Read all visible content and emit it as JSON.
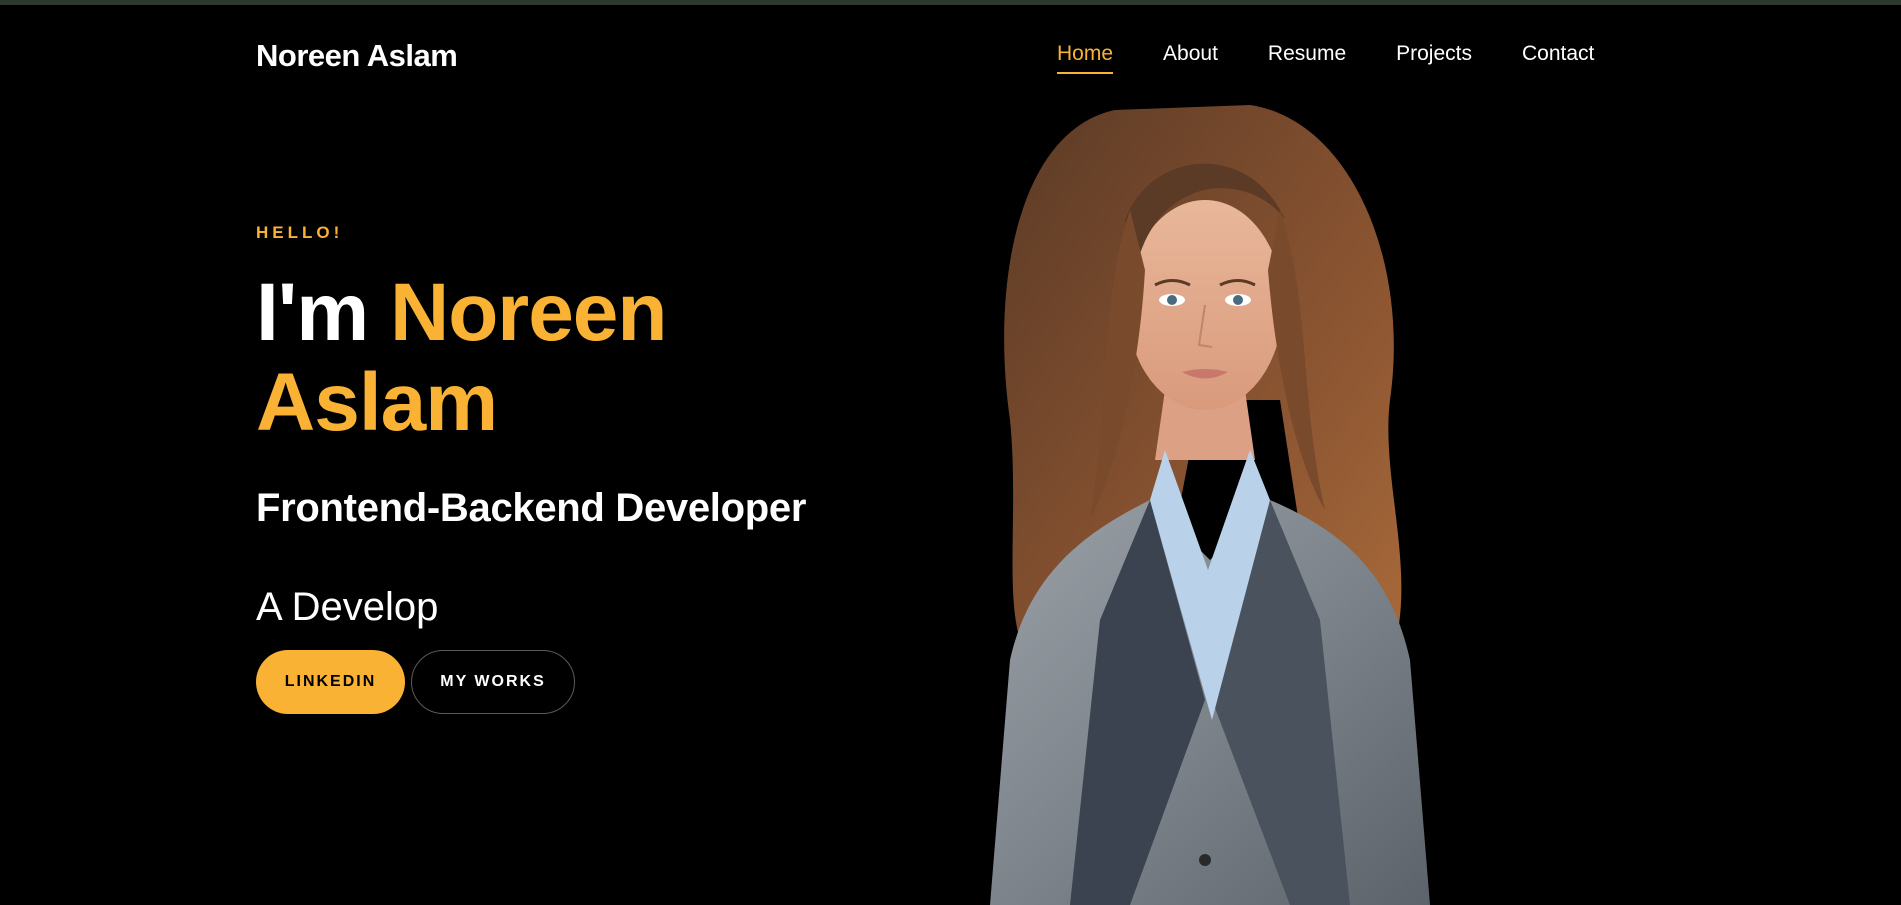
{
  "header": {
    "brand": "Noreen Aslam",
    "nav": [
      {
        "label": "Home",
        "active": true
      },
      {
        "label": "About",
        "active": false
      },
      {
        "label": "Resume",
        "active": false
      },
      {
        "label": "Projects",
        "active": false
      },
      {
        "label": "Contact",
        "active": false
      }
    ]
  },
  "hero": {
    "greeting": "HELLO!",
    "headline_prefix": "I'm ",
    "headline_name_line1": "Noreen",
    "headline_name_line2": "Aslam",
    "role": "Frontend-Backend Developer",
    "typed_text": "A Develop",
    "buttons": {
      "primary": "LINKEDIN",
      "secondary": "MY WORKS"
    }
  },
  "colors": {
    "accent": "#f9b233",
    "background": "#000000",
    "text": "#ffffff"
  }
}
